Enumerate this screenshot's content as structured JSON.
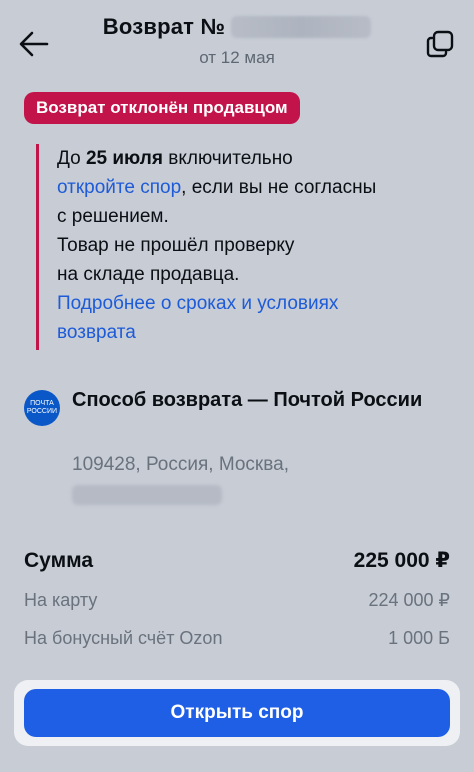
{
  "header": {
    "title_prefix": "Возврат №",
    "subtitle": "от 12 мая"
  },
  "status": {
    "badge": "Возврат отклонён продавцом",
    "color": "#c2144b"
  },
  "info": {
    "line1_prefix": "До ",
    "line1_bold": "25 июля",
    "line1_suffix": " включительно",
    "line2_link": "откройте спор",
    "line2_rest": ", если вы не согласны",
    "line3": "с решением.",
    "line4": "Товар не прошёл проверку",
    "line5": "на складе продавца.",
    "more_link_1": "Подробнее о сроках и условиях",
    "more_link_2": "возврата"
  },
  "method": {
    "logo_text": "ПОЧТА РОССИИ",
    "title": "Способ возврата — Почтой России",
    "address_line1": "109428, Россия, Москва,"
  },
  "totals": {
    "sum_label": "Сумма",
    "sum_value": "225 000 ₽",
    "card_label": "На карту",
    "card_value": "224 000 ₽",
    "bonus_label": "На бонусный счёт Ozon",
    "bonus_value": "1 000 Б"
  },
  "footer": {
    "button_label": "Открыть спор",
    "accent": "#1f5fe6"
  }
}
